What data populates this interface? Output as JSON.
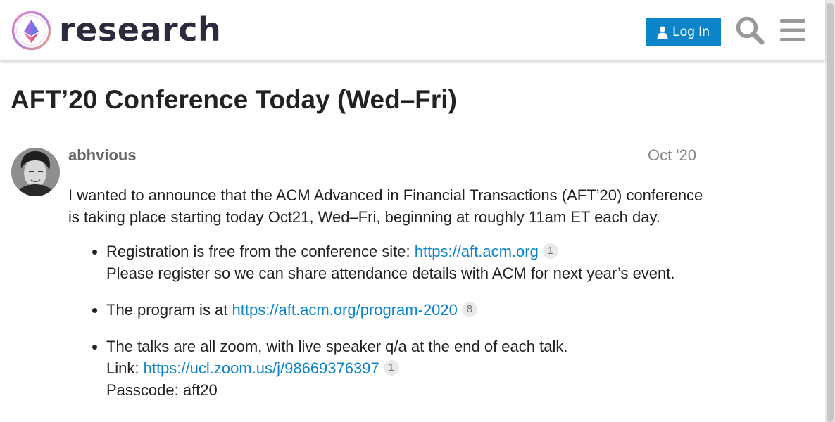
{
  "header": {
    "brand": "research",
    "login_label": "Log In",
    "colors": {
      "accent": "#0a85c9"
    },
    "icons": [
      "logo-icon",
      "user-icon",
      "search-icon",
      "hamburger-menu-icon"
    ]
  },
  "topic": {
    "title": "AFT’20 Conference Today (Wed–Fri)"
  },
  "post": {
    "username": "abhvious",
    "date": "Oct '20",
    "intro": "I wanted to announce that the ACM Advanced in Financial Transactions (AFT’20) conference is taking place starting today Oct21, Wed–Fri, beginning at roughly 11am ET each day.",
    "items": [
      {
        "prefix": "Registration is free from the conference site: ",
        "link": "https://aft.acm.org",
        "clicks": "1",
        "line2": "Please register so we can share attendance details with ACM for next year’s event."
      },
      {
        "prefix": "The program is at ",
        "link": "https://aft.acm.org/program-2020",
        "clicks": "8"
      },
      {
        "line1": "The talks are all zoom, with live speaker q/a at the end of each talk.",
        "prefix": "Link: ",
        "link": "https://ucl.zoom.us/j/98669376397",
        "clicks": "1",
        "line3": "Passcode: aft20"
      }
    ]
  }
}
